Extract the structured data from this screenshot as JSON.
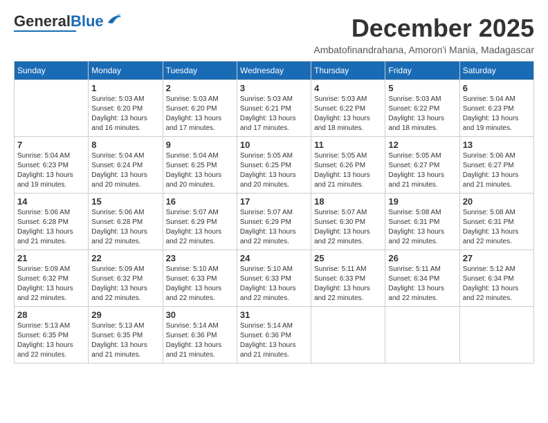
{
  "header": {
    "logo_general": "General",
    "logo_blue": "Blue",
    "month_year": "December 2025",
    "location": "Ambatofinandrahana, Amoron'i Mania, Madagascar"
  },
  "weekdays": [
    "Sunday",
    "Monday",
    "Tuesday",
    "Wednesday",
    "Thursday",
    "Friday",
    "Saturday"
  ],
  "weeks": [
    [
      {
        "day": "",
        "info": ""
      },
      {
        "day": "1",
        "info": "Sunrise: 5:03 AM\nSunset: 6:20 PM\nDaylight: 13 hours\nand 16 minutes."
      },
      {
        "day": "2",
        "info": "Sunrise: 5:03 AM\nSunset: 6:20 PM\nDaylight: 13 hours\nand 17 minutes."
      },
      {
        "day": "3",
        "info": "Sunrise: 5:03 AM\nSunset: 6:21 PM\nDaylight: 13 hours\nand 17 minutes."
      },
      {
        "day": "4",
        "info": "Sunrise: 5:03 AM\nSunset: 6:22 PM\nDaylight: 13 hours\nand 18 minutes."
      },
      {
        "day": "5",
        "info": "Sunrise: 5:03 AM\nSunset: 6:22 PM\nDaylight: 13 hours\nand 18 minutes."
      },
      {
        "day": "6",
        "info": "Sunrise: 5:04 AM\nSunset: 6:23 PM\nDaylight: 13 hours\nand 19 minutes."
      }
    ],
    [
      {
        "day": "7",
        "info": "Sunrise: 5:04 AM\nSunset: 6:23 PM\nDaylight: 13 hours\nand 19 minutes."
      },
      {
        "day": "8",
        "info": "Sunrise: 5:04 AM\nSunset: 6:24 PM\nDaylight: 13 hours\nand 20 minutes."
      },
      {
        "day": "9",
        "info": "Sunrise: 5:04 AM\nSunset: 6:25 PM\nDaylight: 13 hours\nand 20 minutes."
      },
      {
        "day": "10",
        "info": "Sunrise: 5:05 AM\nSunset: 6:25 PM\nDaylight: 13 hours\nand 20 minutes."
      },
      {
        "day": "11",
        "info": "Sunrise: 5:05 AM\nSunset: 6:26 PM\nDaylight: 13 hours\nand 21 minutes."
      },
      {
        "day": "12",
        "info": "Sunrise: 5:05 AM\nSunset: 6:27 PM\nDaylight: 13 hours\nand 21 minutes."
      },
      {
        "day": "13",
        "info": "Sunrise: 5:06 AM\nSunset: 6:27 PM\nDaylight: 13 hours\nand 21 minutes."
      }
    ],
    [
      {
        "day": "14",
        "info": "Sunrise: 5:06 AM\nSunset: 6:28 PM\nDaylight: 13 hours\nand 21 minutes."
      },
      {
        "day": "15",
        "info": "Sunrise: 5:06 AM\nSunset: 6:28 PM\nDaylight: 13 hours\nand 22 minutes."
      },
      {
        "day": "16",
        "info": "Sunrise: 5:07 AM\nSunset: 6:29 PM\nDaylight: 13 hours\nand 22 minutes."
      },
      {
        "day": "17",
        "info": "Sunrise: 5:07 AM\nSunset: 6:29 PM\nDaylight: 13 hours\nand 22 minutes."
      },
      {
        "day": "18",
        "info": "Sunrise: 5:07 AM\nSunset: 6:30 PM\nDaylight: 13 hours\nand 22 minutes."
      },
      {
        "day": "19",
        "info": "Sunrise: 5:08 AM\nSunset: 6:31 PM\nDaylight: 13 hours\nand 22 minutes."
      },
      {
        "day": "20",
        "info": "Sunrise: 5:08 AM\nSunset: 6:31 PM\nDaylight: 13 hours\nand 22 minutes."
      }
    ],
    [
      {
        "day": "21",
        "info": "Sunrise: 5:09 AM\nSunset: 6:32 PM\nDaylight: 13 hours\nand 22 minutes."
      },
      {
        "day": "22",
        "info": "Sunrise: 5:09 AM\nSunset: 6:32 PM\nDaylight: 13 hours\nand 22 minutes."
      },
      {
        "day": "23",
        "info": "Sunrise: 5:10 AM\nSunset: 6:33 PM\nDaylight: 13 hours\nand 22 minutes."
      },
      {
        "day": "24",
        "info": "Sunrise: 5:10 AM\nSunset: 6:33 PM\nDaylight: 13 hours\nand 22 minutes."
      },
      {
        "day": "25",
        "info": "Sunrise: 5:11 AM\nSunset: 6:33 PM\nDaylight: 13 hours\nand 22 minutes."
      },
      {
        "day": "26",
        "info": "Sunrise: 5:11 AM\nSunset: 6:34 PM\nDaylight: 13 hours\nand 22 minutes."
      },
      {
        "day": "27",
        "info": "Sunrise: 5:12 AM\nSunset: 6:34 PM\nDaylight: 13 hours\nand 22 minutes."
      }
    ],
    [
      {
        "day": "28",
        "info": "Sunrise: 5:13 AM\nSunset: 6:35 PM\nDaylight: 13 hours\nand 22 minutes."
      },
      {
        "day": "29",
        "info": "Sunrise: 5:13 AM\nSunset: 6:35 PM\nDaylight: 13 hours\nand 21 minutes."
      },
      {
        "day": "30",
        "info": "Sunrise: 5:14 AM\nSunset: 6:36 PM\nDaylight: 13 hours\nand 21 minutes."
      },
      {
        "day": "31",
        "info": "Sunrise: 5:14 AM\nSunset: 6:36 PM\nDaylight: 13 hours\nand 21 minutes."
      },
      {
        "day": "",
        "info": ""
      },
      {
        "day": "",
        "info": ""
      },
      {
        "day": "",
        "info": ""
      }
    ]
  ]
}
